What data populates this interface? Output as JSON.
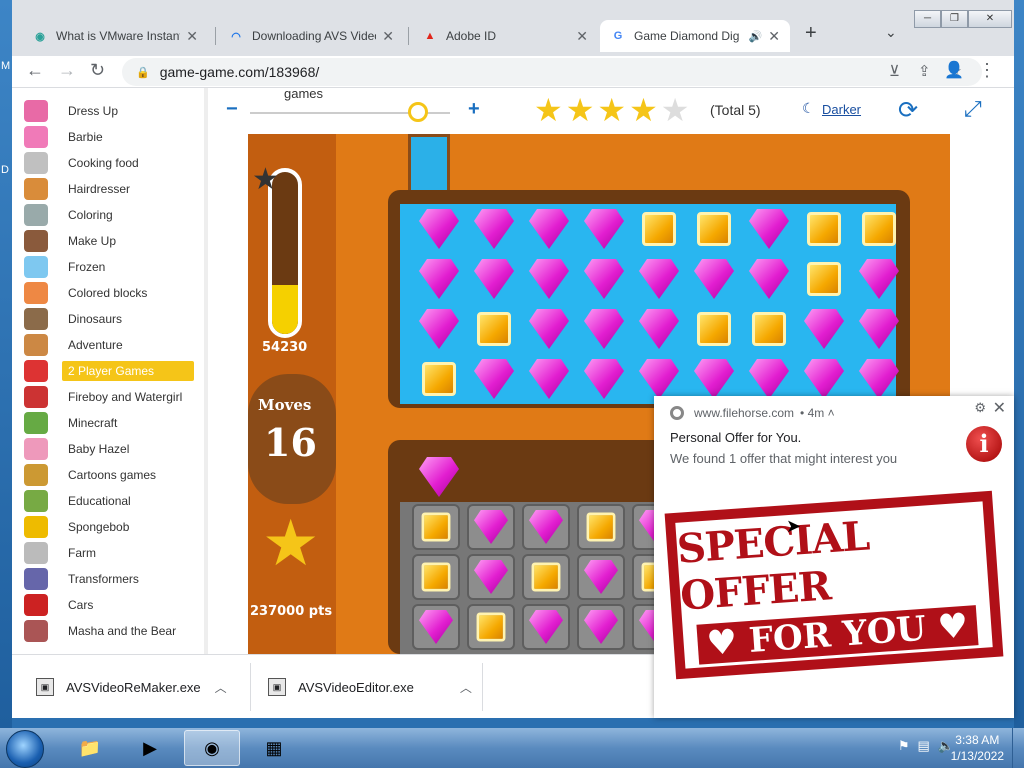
{
  "browser": {
    "tabs": [
      {
        "title": "What is VMware Instant",
        "icon": "vmware-icon"
      },
      {
        "title": "Downloading AVS Video",
        "icon": "avs-icon"
      },
      {
        "title": "Adobe ID",
        "icon": "adobe-icon"
      },
      {
        "title": "Game Diamond Dig",
        "icon": "google-icon",
        "audio": "🔊"
      }
    ],
    "new_tab": "+",
    "url": "game-game.com/183968/"
  },
  "sidebar": {
    "items": [
      {
        "label": "Dress Up"
      },
      {
        "label": "Barbie"
      },
      {
        "label": "Cooking food"
      },
      {
        "label": "Hairdresser"
      },
      {
        "label": "Coloring"
      },
      {
        "label": "Make Up"
      },
      {
        "label": "Frozen"
      },
      {
        "label": "Colored blocks"
      },
      {
        "label": "Dinosaurs"
      },
      {
        "label": "Adventure"
      },
      {
        "label": "2 Player Games"
      },
      {
        "label": "Fireboy and Watergirl"
      },
      {
        "label": "Minecraft"
      },
      {
        "label": "Baby Hazel"
      },
      {
        "label": "Cartoons games"
      },
      {
        "label": "Educational"
      },
      {
        "label": "Spongebob"
      },
      {
        "label": "Farm"
      },
      {
        "label": "Transformers"
      },
      {
        "label": "Cars"
      },
      {
        "label": "Masha and the Bear"
      }
    ],
    "selected_index": 10
  },
  "gamebar": {
    "games_label": "games",
    "rating_stars": 4,
    "rating_max": 5,
    "total_label": "(Total 5)",
    "darker_label": "Darker"
  },
  "game": {
    "score": "54230",
    "meter_fraction": 0.3,
    "moves_label": "Moves",
    "moves_value": "16",
    "points": "237000 pts"
  },
  "downloads": [
    {
      "filename": "AVSVideoReMaker.exe"
    },
    {
      "filename": "AVSVideoEditor.exe"
    }
  ],
  "notification": {
    "source": "www.filehorse.com",
    "age": "• 4m ˄",
    "title": "Personal Offer for You.",
    "body": "We found 1 offer that might interest you",
    "image_line1": "SPECIAL OFFER",
    "image_line2": "♥ FOR YOU ♥"
  },
  "taskbar": {
    "time": "3:38 AM",
    "date": "1/13/2022"
  },
  "desktop": {
    "edge_labels": [
      "M",
      "D"
    ]
  },
  "colors": {
    "selected_category": "#f5c518",
    "link_blue": "#1a6fc0",
    "offer_red": "#b01018"
  }
}
